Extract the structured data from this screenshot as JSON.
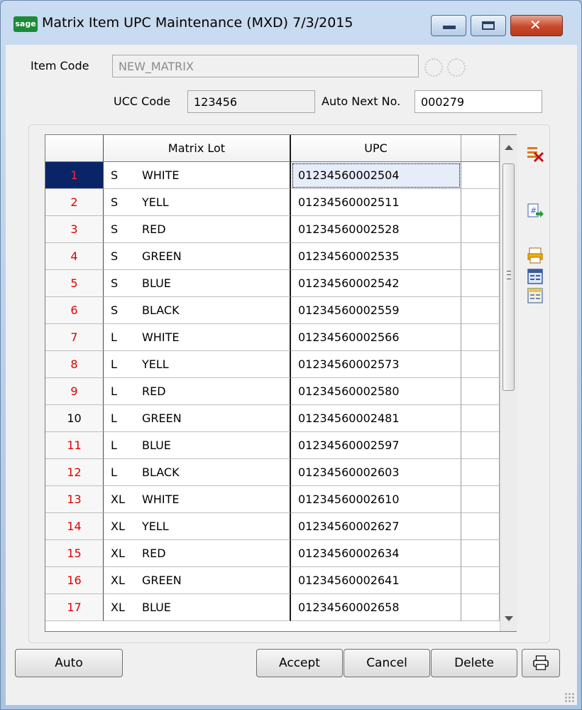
{
  "window": {
    "app_icon_text": "sage",
    "title": "Matrix Item UPC Maintenance (MXD) 7/3/2015",
    "close_glyph": "✕"
  },
  "form": {
    "item_code_label": "Item Code",
    "item_code_value": "NEW_MATRIX",
    "ucc_code_label": "UCC Code",
    "ucc_code_value": "123456",
    "auto_next_label": "Auto Next No.",
    "auto_next_value": "000279"
  },
  "grid": {
    "columns": [
      "",
      "Matrix Lot",
      "UPC"
    ],
    "rows": [
      {
        "num": "1",
        "size": "S",
        "color": "WHITE",
        "upc": "01234560002504"
      },
      {
        "num": "2",
        "size": "S",
        "color": "YELL",
        "upc": "01234560002511"
      },
      {
        "num": "3",
        "size": "S",
        "color": "RED",
        "upc": "01234560002528"
      },
      {
        "num": "4",
        "size": "S",
        "color": "GREEN",
        "upc": "01234560002535"
      },
      {
        "num": "5",
        "size": "S",
        "color": "BLUE",
        "upc": "01234560002542"
      },
      {
        "num": "6",
        "size": "S",
        "color": "BLACK",
        "upc": "01234560002559"
      },
      {
        "num": "7",
        "size": "L",
        "color": "WHITE",
        "upc": "01234560002566"
      },
      {
        "num": "8",
        "size": "L",
        "color": "YELL",
        "upc": "01234560002573"
      },
      {
        "num": "9",
        "size": "L",
        "color": "RED",
        "upc": "01234560002580"
      },
      {
        "num": "10",
        "size": "L",
        "color": "GREEN",
        "upc": "01234560002481"
      },
      {
        "num": "11",
        "size": "L",
        "color": "BLUE",
        "upc": "01234560002597"
      },
      {
        "num": "12",
        "size": "L",
        "color": "BLACK",
        "upc": "01234560002603"
      },
      {
        "num": "13",
        "size": "XL",
        "color": "WHITE",
        "upc": "01234560002610"
      },
      {
        "num": "14",
        "size": "XL",
        "color": "YELL",
        "upc": "01234560002627"
      },
      {
        "num": "15",
        "size": "XL",
        "color": "RED",
        "upc": "01234560002634"
      },
      {
        "num": "16",
        "size": "XL",
        "color": "GREEN",
        "upc": "01234560002641"
      },
      {
        "num": "17",
        "size": "XL",
        "color": "BLUE",
        "upc": "01234560002658"
      }
    ],
    "selected_row": "1",
    "black_number_rows": [
      "10"
    ],
    "row_number_color": "#e00000",
    "selected_row_bg": "#0a2468"
  },
  "sidebar_icons": [
    "delete-line-icon",
    "renumber-icon",
    "print-icon",
    "grid-settings-icon",
    "grid-default-icon"
  ],
  "buttons": {
    "auto": "Auto",
    "accept": "Accept",
    "cancel": "Cancel",
    "delete": "Delete",
    "print_icon": "printer-icon"
  }
}
